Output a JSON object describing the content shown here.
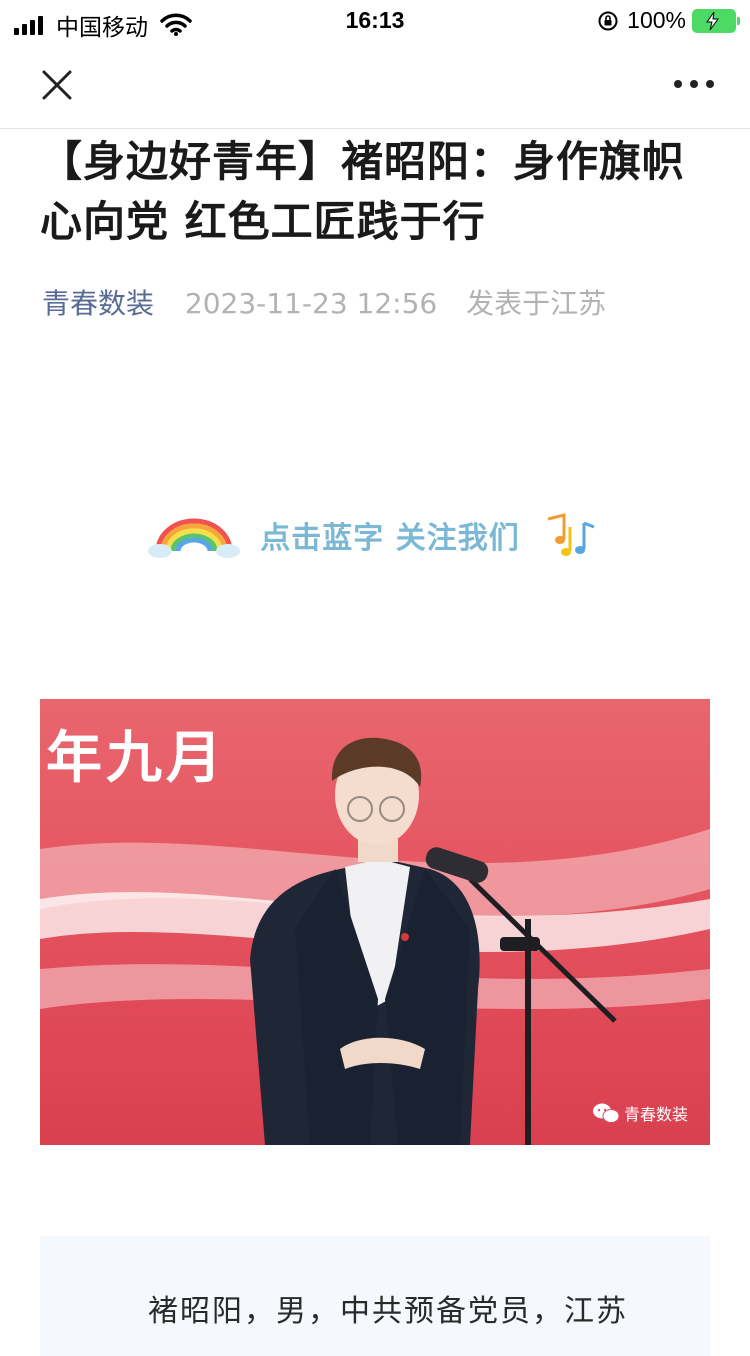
{
  "status_bar": {
    "carrier": "中国移动",
    "time": "16:13",
    "battery": "100%"
  },
  "nav": {
    "close_icon": "close-icon",
    "more_icon": "more-icon"
  },
  "article": {
    "title": "【身边好青年】褚昭阳：身作旗帜心向党 红色工匠践于行",
    "account": "青春数装",
    "date": "2023-11-23 12:56",
    "location": "发表于江苏",
    "follow_text": "点击蓝字 关注我们",
    "photo": {
      "banner_text": "年九月",
      "watermark": "青春数装"
    },
    "intro": "褚昭阳，男，中共预备党员，江苏"
  },
  "colors": {
    "account_link": "#576b95",
    "follow_text": "#7ab8d6",
    "photo_background": "#e34f5c",
    "battery": "#4cd964"
  }
}
